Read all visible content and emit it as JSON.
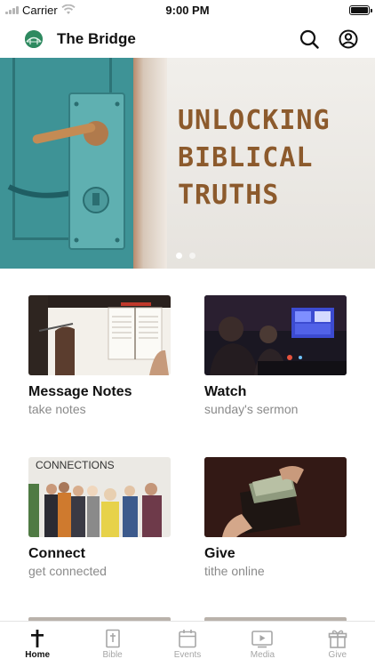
{
  "status_bar": {
    "carrier": "Carrier",
    "time": "9:00 PM"
  },
  "header": {
    "title": "The Bridge",
    "search_icon": "search-icon",
    "profile_icon": "user-circle-icon"
  },
  "hero": {
    "lines": [
      "UNLOCKING",
      "BIBLICAL",
      "TRUTHS"
    ],
    "slide_count": 2,
    "active_slide": 1,
    "text_color": "#8c5a2c"
  },
  "cards": [
    {
      "title": "Message Notes",
      "subtitle": "take notes"
    },
    {
      "title": "Watch",
      "subtitle": "sunday's sermon"
    },
    {
      "title": "Connect",
      "subtitle": "get connected",
      "image_text": "CONNECTIONS"
    },
    {
      "title": "Give",
      "subtitle": "tithe online"
    }
  ],
  "tabs": [
    {
      "label": "Home",
      "icon": "cross-icon",
      "active": true
    },
    {
      "label": "Bible",
      "icon": "bible-icon",
      "active": false
    },
    {
      "label": "Events",
      "icon": "calendar-icon",
      "active": false
    },
    {
      "label": "Media",
      "icon": "play-icon",
      "active": false
    },
    {
      "label": "Give",
      "icon": "gift-icon",
      "active": false
    }
  ]
}
